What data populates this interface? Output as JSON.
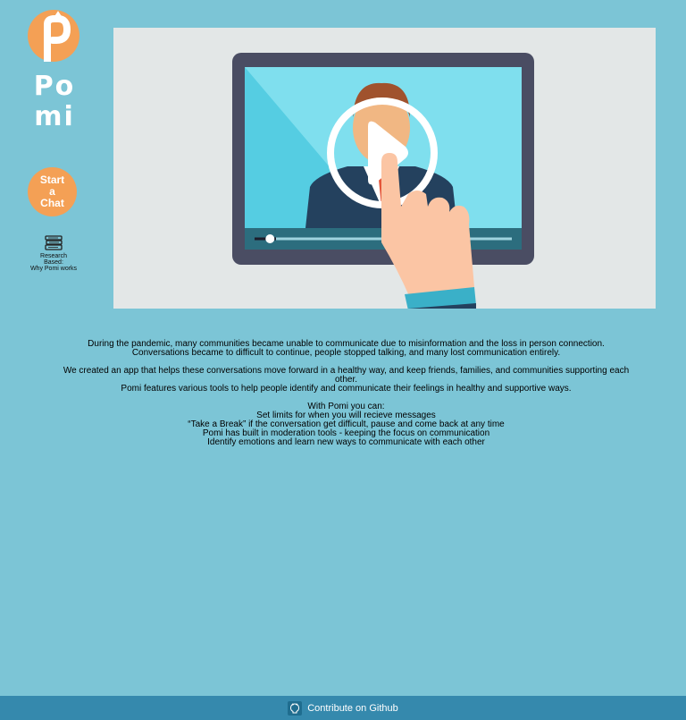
{
  "sidebar": {
    "logo_letters": [
      "Po",
      "mi"
    ],
    "start_chat_lines": [
      "Start",
      "a",
      "Chat"
    ],
    "research_lines": [
      "Research",
      "Based:",
      "Why Pomi works"
    ]
  },
  "video": {
    "icon": "play-icon",
    "progress": 0.06
  },
  "content": {
    "paragraphs": [
      "During the pandemic, many communities became unable to communicate due to misinformation and the loss in person connection.",
      "Conversations became to difficult to continue, people stopped talking, and many lost communication entirely.",
      "",
      "We created an app that helps these conversations move forward in a healthy way, and keep friends, families, and communities supporting each other.",
      "Pomi features various tools to help people identify and communicate their feelings in healthy and supportive ways.",
      "",
      "With Pomi you can:",
      "Set limits for when you will recieve messages",
      "“Take a Break” if the conversation get difficult, pause and come back at any time",
      "Pomi has built in moderation tools - keeping the focus on communication",
      "Identify emotions and learn new ways to communicate with each other"
    ]
  },
  "footer": {
    "github_label": "Contribute on Github",
    "icon": "github-icon"
  },
  "colors": {
    "background": "#7cc5d6",
    "accent": "#f4a055",
    "footer": "#3589ad"
  }
}
